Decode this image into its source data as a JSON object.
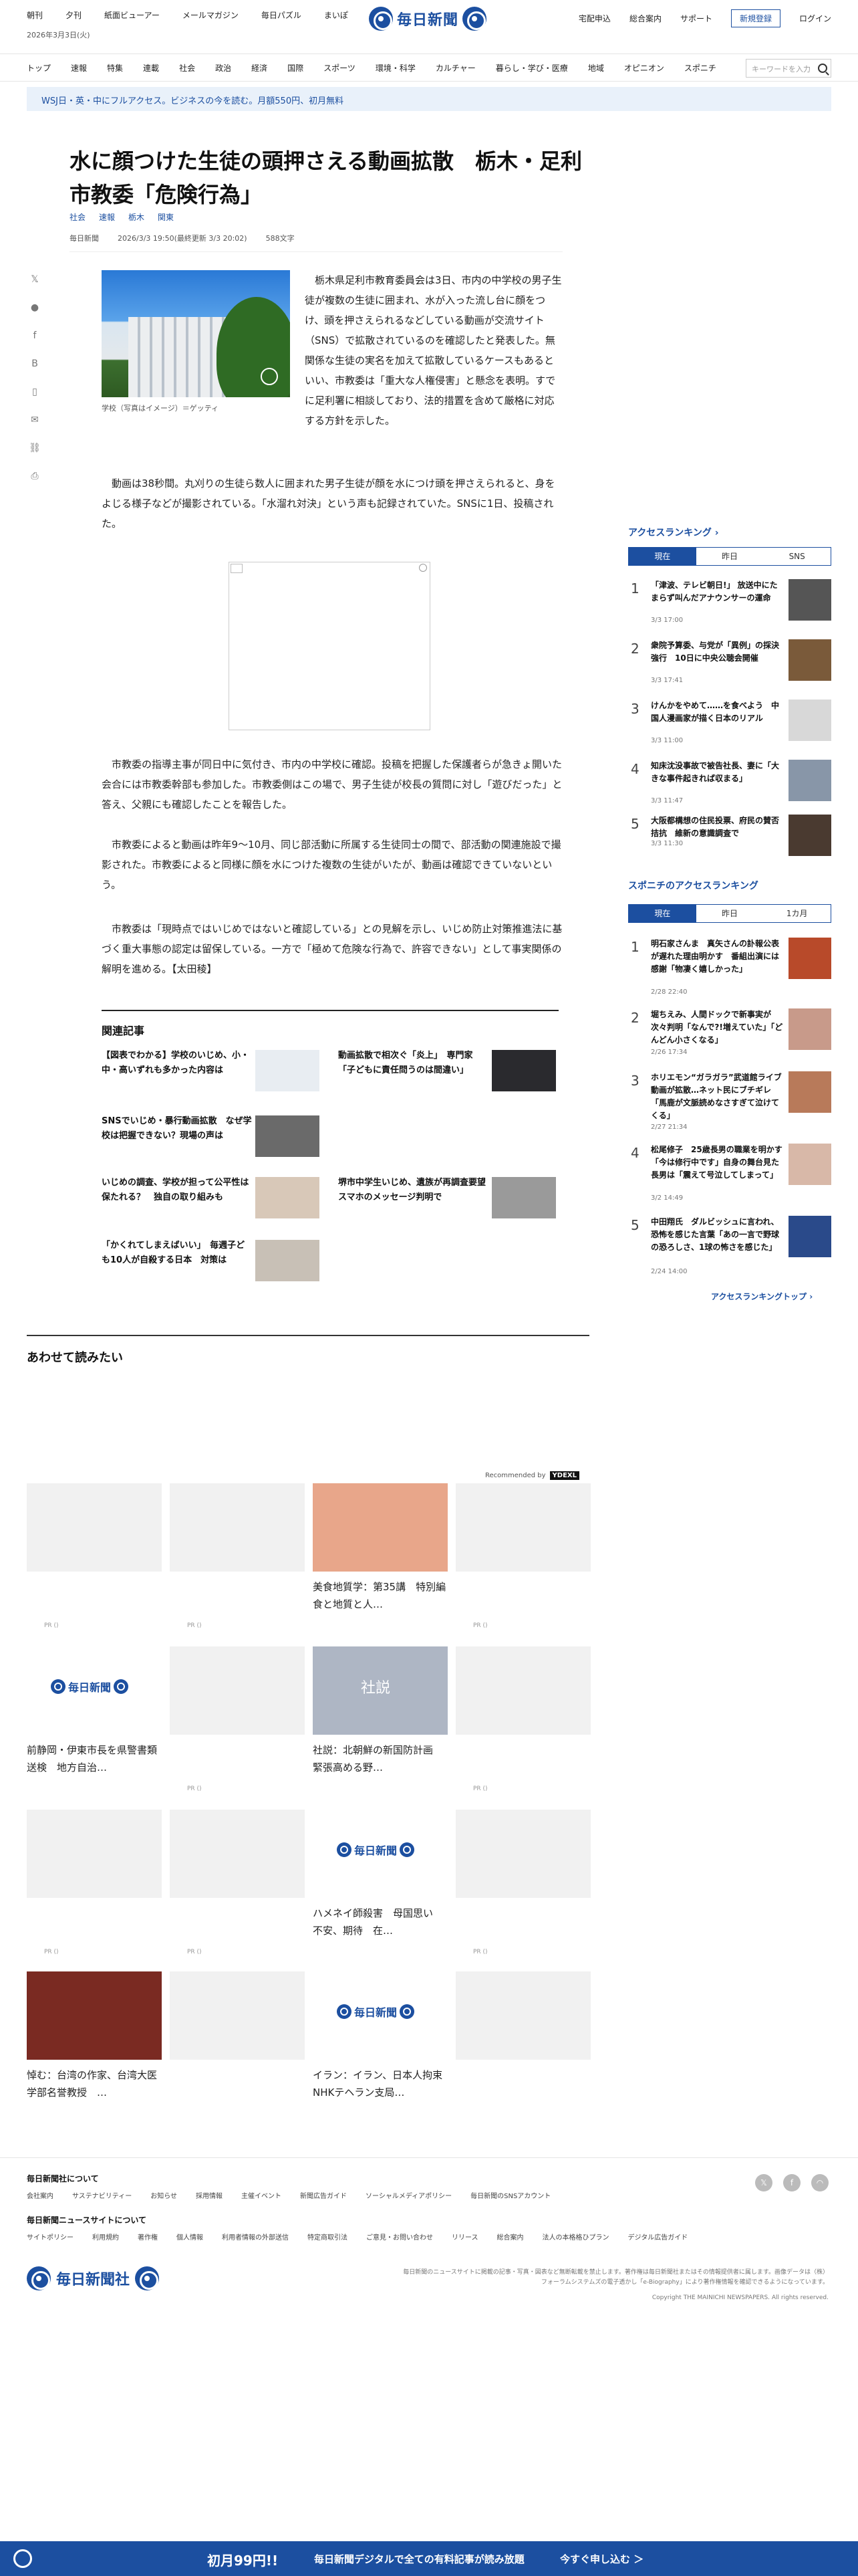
{
  "topbar": {
    "links": [
      "朝刊",
      "夕刊",
      "紙面ビューアー",
      "メールマガジン",
      "毎日パズル",
      "まいぽ"
    ],
    "date": "2026年3月3日(火)",
    "brand": "毎日新聞",
    "right_links": [
      "宅配申込",
      "総合案内",
      "サポート"
    ],
    "register": "新規登録",
    "login": "ログイン"
  },
  "nav": {
    "items": [
      "トップ",
      "速報",
      "特集",
      "連載",
      "社会",
      "政治",
      "経済",
      "国際",
      "スポーツ",
      "環境・科学",
      "カルチャー",
      "暮らし・学び・医療",
      "地域",
      "オピニオン",
      "スポニチ"
    ],
    "search_placeholder": "キーワードを入力"
  },
  "promo": {
    "text": "WSJ日・英・中にフルアクセス。ビジネスの今を読む。月額550円、初月無料"
  },
  "article": {
    "headline": "水に顔つけた生徒の頭押さえる動画拡散　栃木・足利市教委「危険行為」",
    "tags": [
      "社会",
      "速報",
      "栃木",
      "関東"
    ],
    "source": "毎日新聞",
    "timestamp": "2026/3/3 19:50(最終更新 3/3 20:02)",
    "chars": "588文字",
    "caption": "学校（写真はイメージ）＝ゲッティ",
    "lead": "栃木県足利市教育委員会は3日、市内の中学校の男子生徒が複数の生徒に囲まれ、水が入った流し台に顔をつけ、頭を押さえられるなどしている動画が交流サイト（SNS）で拡散されているのを確認したと発表した。無関係な生徒の実名を加えて拡散しているケースもあるといい、市教委は「重大な人権侵害」と懸念を表明。すでに足利署に相談しており、法的措置を含めて厳格に対応する方針を示した。",
    "p1": "動画は38秒間。丸刈りの生徒ら数人に囲まれた男子生徒が顔を水につけ頭を押さえられると、身をよじる様子などが撮影されている。「水溜れ対決」という声も記録されていた。SNSに1日、投稿された。",
    "p2": "市教委の指導主事が同日中に気付き、市内の中学校に確認。投稿を把握した保護者らが急きょ開いた会合には市教委幹部も参加した。市教委側はこの場で、男子生徒が校長の質問に対し「遊びだった」と答え、父親にも確認したことを報告した。",
    "p3": "市教委によると動画は昨年9～10月、同じ部活動に所属する生徒同士の間で、部活動の関連施設で撮影された。市教委によると同様に顔を水につけた複数の生徒がいたが、動画は確認できていないという。",
    "p4": "市教委は「現時点ではいじめではないと確認している」との見解を示し、いじめ防止対策推進法に基づく重大事態の認定は留保している。一方で「極めて危険な行為で、許容できない」として事実関係の解明を進める。【太田稜】"
  },
  "related": {
    "title": "関連記事",
    "items": [
      "【図表でわかる】学校のいじめ、小・中・高いずれも多かった内容は",
      "動画拡散で相次ぐ「炎上」　専門家「子どもに責任問うのは間違い」",
      "SNSでいじめ・暴行動画拡散　なぜ学校は把握できない？現場の声は",
      "いじめの調査、学校が担って公平性は保たれる？　独自の取り組みも",
      "堺市中学生いじめ、遺族が再調査要望　スマホのメッセージ判明で",
      "「かくれてしまえばいい」　毎週子ども10人が自殺する日本　対策は"
    ]
  },
  "recommend": {
    "title": "あわせて読みたい",
    "recommended_by": "Recommended by",
    "recommended_brand": "YDEXL",
    "pr": "PR ()",
    "cards": [
      "美食地質学：第35講　特別編　食と地質と人…",
      "前静岡・伊東市長を県警書類送検　地方自治…",
      "社説：北朝鮮の新国防計画　緊張高める野…",
      "ハメネイ師殺害　母国思い　不安、期待　在…",
      "悼む：台湾の作家、台湾大医学部名誉教授　…",
      "イラン：イラン、日本人拘束　NHKテヘラン支局…"
    ],
    "stamp": "社説"
  },
  "ranking": {
    "title": "アクセスランキング",
    "tabs": [
      "現在",
      "昨日",
      "SNS"
    ],
    "items": [
      {
        "title": "「津波、テレビ朝日!」 放送中にたまらず叫んだアナウンサーの運命",
        "date": "3/3 17:00"
      },
      {
        "title": "衆院予算委、与党が「異例」の採決強行　10日に中央公聴会開催",
        "date": "3/3 17:41"
      },
      {
        "title": "けんかをやめて……を食べよう　中国人漫画家が描く日本のリアル",
        "date": "3/3 11:00"
      },
      {
        "title": "知床沈没事故で被告社長、妻に「大きな事件起きれば収まる」",
        "date": "3/3 11:47"
      },
      {
        "title": "大阪都構想の住民投票、府民の賛否拮抗　維新の意識調査で",
        "date": "3/3 11:30"
      }
    ],
    "sponichi_title": "スポニチのアクセスランキング",
    "sponichi_tabs": [
      "現在",
      "昨日",
      "1カ月"
    ],
    "sponichi_items": [
      {
        "title": "明石家さんま　真矢さんの訃報公表が遅れた理由明かす　番組出演には感謝「物凄く嬉しかった」",
        "date": "2/28 22:40"
      },
      {
        "title": "堀ちえみ、人間ドックで新事実が次々判明「なんで?!増えていた」「どんどん小さくなる」",
        "date": "2/26 17:34"
      },
      {
        "title": "ホリエモン“ガラガラ”武道館ライブ動画が拡散…ネット民にブチギレ「馬鹿が文脈読めなさすぎて泣けてくる」",
        "date": "2/27 21:34"
      },
      {
        "title": "松尾修子　25歳長男の職業を明かす「今は修行中です」自身の舞台見た長男は「震えて号泣してしまって」",
        "date": "3/2 14:49"
      },
      {
        "title": "中田翔氏　ダルビッシュに言われ、恐怖を感じた言葉「あの一言で野球の恐ろしさ、1球の怖さを感じた」",
        "date": "2/24 14:00"
      }
    ],
    "more": "アクセスランキングトップ"
  },
  "footer": {
    "about": "毎日新聞社について",
    "links1": [
      "会社案内",
      "サステナビリティー",
      "お知らせ",
      "採用情報",
      "主催イベント",
      "新聞広告ガイド",
      "ソーシャルメディアポリシー",
      "毎日新聞のSNSアカウント"
    ],
    "site": "毎日新聞ニュースサイトについて",
    "links2": [
      "サイトポリシー",
      "利用規約",
      "著作権",
      "個人情報",
      "利用者情報の外部送信",
      "特定商取引法",
      "ご意見・お問い合わせ",
      "リリース",
      "総合案内",
      "法人の本格格ひプラン",
      "デジタル広告ガイド"
    ],
    "company": "毎日新聞社",
    "note": "毎日新聞のニュースサイトに掲載の記事・写真・図表など無断転載を禁止します。著作権は毎日新聞社またはその情報提供者に属します。画像データは（株）フォーラムシステムズの電子透かし「e-Biography」により著作権情報を確認できるようになっています。",
    "copyright": "Copyright THE MAINICHI NEWSPAPERS. All rights reserved."
  },
  "cta": {
    "price": "初月99円!!",
    "text": "毎日新聞デジタルで全ての有料記事が読み放題",
    "action": "今すぐ申し込む ＞"
  }
}
